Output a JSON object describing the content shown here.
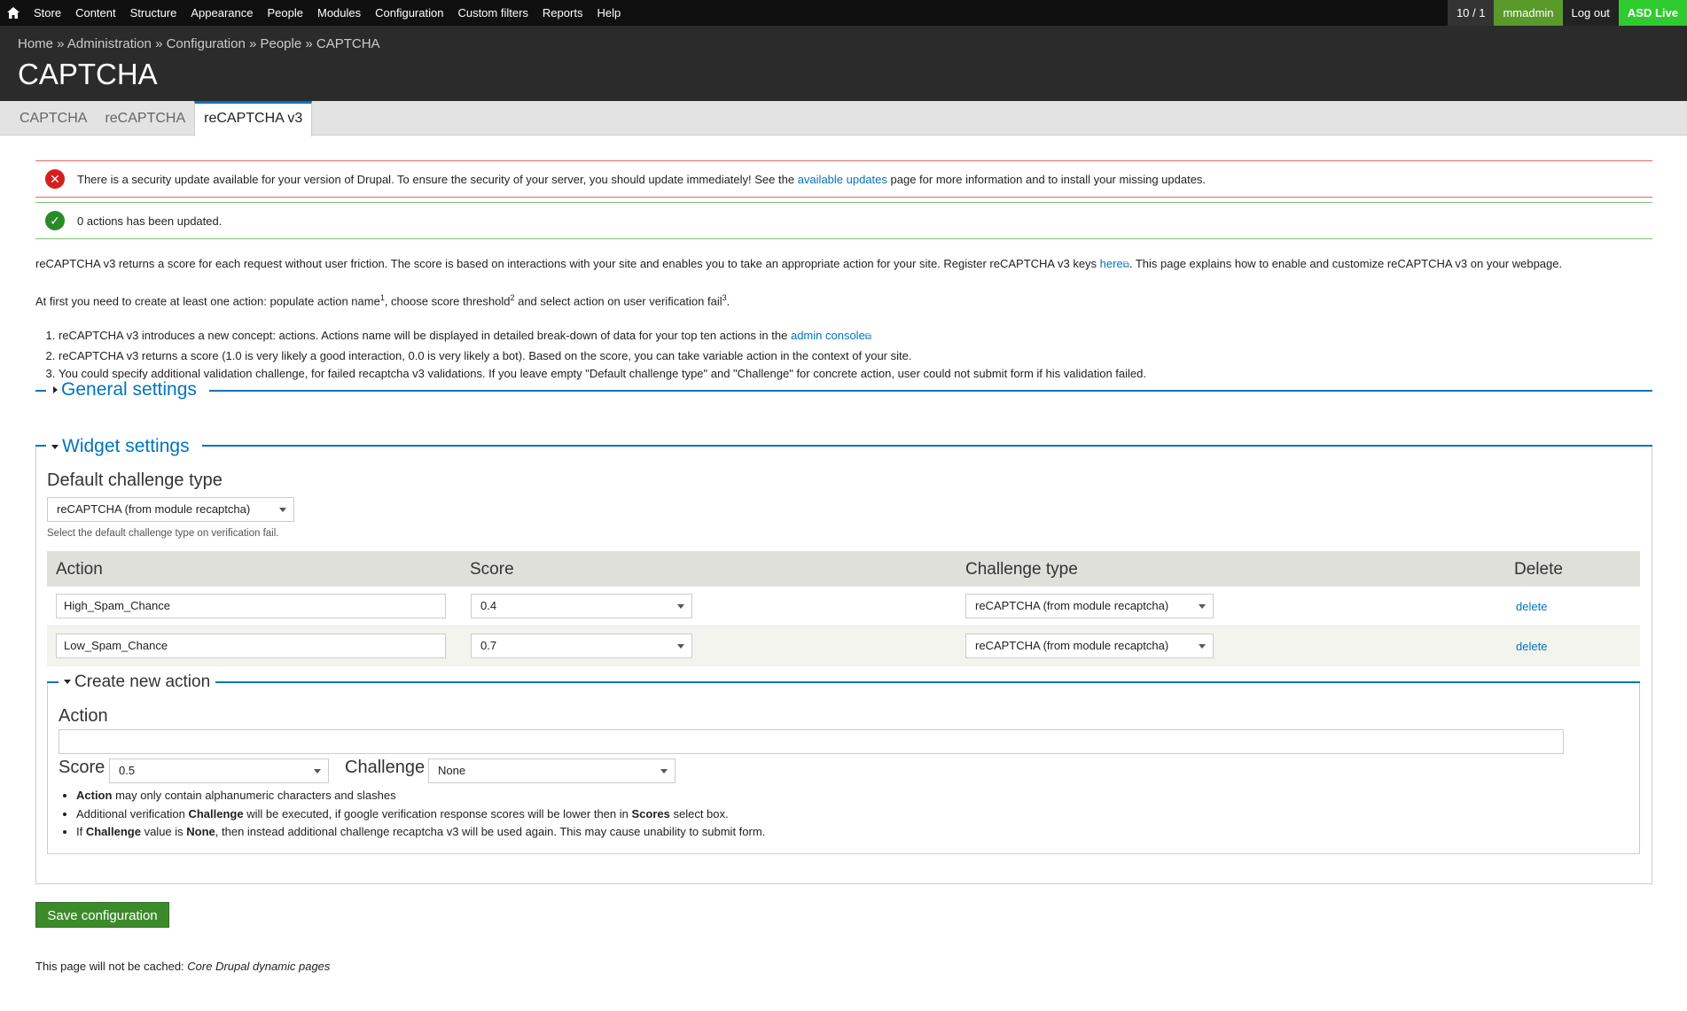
{
  "toolbar": {
    "menu": [
      "Store",
      "Content",
      "Structure",
      "Appearance",
      "People",
      "Modules",
      "Configuration",
      "Custom filters",
      "Reports",
      "Help"
    ],
    "counter": "10 / 1",
    "user": "mmadmin",
    "logout": "Log out",
    "live": "ASD Live"
  },
  "breadcrumb": "Home » Administration » Configuration » People » CAPTCHA",
  "page_title": "CAPTCHA",
  "tabs": [
    "CAPTCHA",
    "reCAPTCHA",
    "reCAPTCHA v3"
  ],
  "messages": {
    "error_before": "There is a security update available for your version of Drupal. To ensure the security of your server, you should update immediately! See the ",
    "error_link": "available updates",
    "error_after": " page for more information and to install your missing updates.",
    "status": "0 actions has been updated."
  },
  "intro": {
    "before": "reCAPTCHA v3 returns a score for each request without user friction. The score is based on interactions with your site and enables you to take an appropriate action for your site. Register reCAPTCHA v3 keys ",
    "link": "here",
    "after": ". This page explains how to enable and customize reCAPTCHA v3 on your webpage."
  },
  "first": {
    "t1": "At first you need to create at least one action: populate action name",
    "s1": "1",
    "t2": ", choose score threshold",
    "s2": "2",
    "t3": " and select action on user verification fail",
    "s3": "3",
    "t4": "."
  },
  "help": {
    "item1_before": "reCAPTCHA v3 introduces a new concept: actions. Actions name will be displayed in detailed break-down of data for your top ten actions in the ",
    "item1_link": "admin console",
    "item2": "reCAPTCHA v3 returns a score (1.0 is very likely a good interaction, 0.0 is very likely a bot). Based on the score, you can take variable action in the context of your site.",
    "item3": "You could specify additional validation challenge, for failed recaptcha v3 validations. If you leave empty \"Default challenge type\" and \"Challenge\" for concrete action, user could not submit form if his validation failed."
  },
  "general_settings": "General settings",
  "widget_settings": "Widget settings",
  "default_challenge": {
    "label": "Default challenge type",
    "value": "reCAPTCHA (from module recaptcha)",
    "description": "Select the default challenge type on verification fail."
  },
  "table": {
    "headers": [
      "Action",
      "Score",
      "Challenge type",
      "Delete"
    ],
    "rows": [
      {
        "action": "High_Spam_Chance",
        "score": "0.4",
        "challenge": "reCAPTCHA (from module recaptcha)",
        "delete": "delete"
      },
      {
        "action": "Low_Spam_Chance",
        "score": "0.7",
        "challenge": "reCAPTCHA (from module recaptcha)",
        "delete": "delete"
      }
    ]
  },
  "create": {
    "legend": "Create new action",
    "action_label": "Action",
    "action_value": "",
    "score_label": "Score",
    "score_value": "0.5",
    "challenge_label": "Challenge",
    "challenge_value": "None",
    "notes": {
      "n1_b": "Action",
      "n1_t": " may only contain alphanumeric characters and slashes",
      "n2_a": "Additional verification ",
      "n2_b1": "Challenge",
      "n2_m": " will be executed, if google verification response scores will be lower then in ",
      "n2_b2": "Scores",
      "n2_t": " select box.",
      "n3_a": "If ",
      "n3_b1": "Challenge",
      "n3_m": " value is ",
      "n3_b2": "None",
      "n3_t": ", then instead additional challenge recaptcha v3 will be used again. This may cause unability to submit form."
    }
  },
  "save_label": "Save configuration",
  "cache_note": {
    "text": "This page will not be cached: ",
    "em": "Core Drupal dynamic pages"
  }
}
